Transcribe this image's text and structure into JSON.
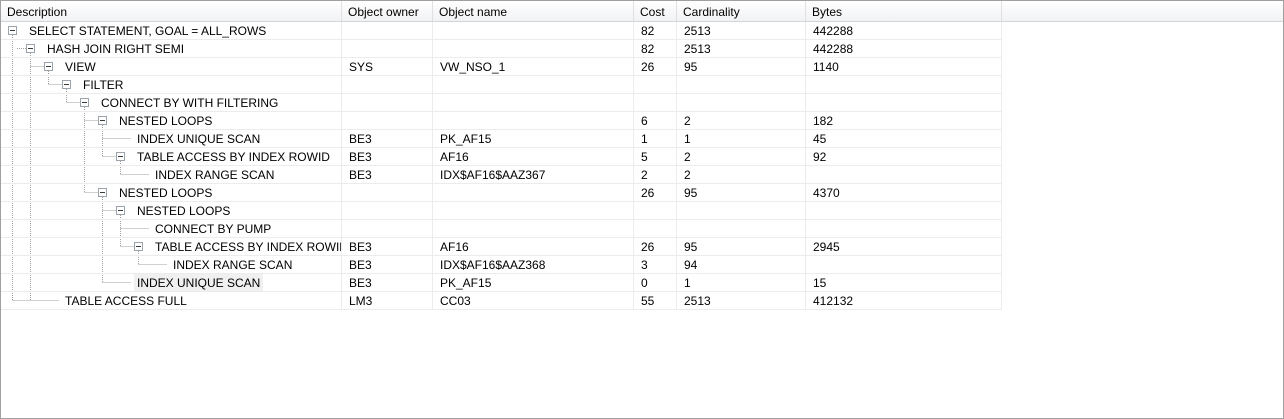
{
  "columns": {
    "description": "Description",
    "object_owner": "Object owner",
    "object_name": "Object name",
    "cost": "Cost",
    "cardinality": "Cardinality",
    "bytes": "Bytes"
  },
  "rows": [
    {
      "description": "SELECT STATEMENT, GOAL = ALL_ROWS",
      "owner": "",
      "name": "",
      "cost": "82",
      "cardinality": "2513",
      "bytes": "442288"
    },
    {
      "description": "HASH JOIN RIGHT SEMI",
      "owner": "",
      "name": "",
      "cost": "82",
      "cardinality": "2513",
      "bytes": "442288"
    },
    {
      "description": "VIEW",
      "owner": "SYS",
      "name": "VW_NSO_1",
      "cost": "26",
      "cardinality": "95",
      "bytes": "1140"
    },
    {
      "description": "FILTER",
      "owner": "",
      "name": "",
      "cost": "",
      "cardinality": "",
      "bytes": ""
    },
    {
      "description": "CONNECT BY WITH FILTERING",
      "owner": "",
      "name": "",
      "cost": "",
      "cardinality": "",
      "bytes": ""
    },
    {
      "description": "NESTED LOOPS",
      "owner": "",
      "name": "",
      "cost": "6",
      "cardinality": "2",
      "bytes": "182"
    },
    {
      "description": "INDEX UNIQUE SCAN",
      "owner": "BE3",
      "name": "PK_AF15",
      "cost": "1",
      "cardinality": "1",
      "bytes": "45"
    },
    {
      "description": "TABLE ACCESS BY INDEX ROWID",
      "owner": "BE3",
      "name": "AF16",
      "cost": "5",
      "cardinality": "2",
      "bytes": "92"
    },
    {
      "description": "INDEX RANGE SCAN",
      "owner": "BE3",
      "name": "IDX$AF16$AAZ367",
      "cost": "2",
      "cardinality": "2",
      "bytes": ""
    },
    {
      "description": "NESTED LOOPS",
      "owner": "",
      "name": "",
      "cost": "26",
      "cardinality": "95",
      "bytes": "4370"
    },
    {
      "description": "NESTED LOOPS",
      "owner": "",
      "name": "",
      "cost": "",
      "cardinality": "",
      "bytes": ""
    },
    {
      "description": "CONNECT BY PUMP",
      "owner": "",
      "name": "",
      "cost": "",
      "cardinality": "",
      "bytes": ""
    },
    {
      "description": "TABLE ACCESS BY INDEX ROWID",
      "owner": "BE3",
      "name": "AF16",
      "cost": "26",
      "cardinality": "95",
      "bytes": "2945"
    },
    {
      "description": "INDEX RANGE SCAN",
      "owner": "BE3",
      "name": "IDX$AF16$AAZ368",
      "cost": "3",
      "cardinality": "94",
      "bytes": ""
    },
    {
      "description": "INDEX UNIQUE SCAN",
      "owner": "BE3",
      "name": "PK_AF15",
      "cost": "0",
      "cardinality": "1",
      "bytes": "15"
    },
    {
      "description": "TABLE ACCESS FULL",
      "owner": "LM3",
      "name": "CC03",
      "cost": "55",
      "cardinality": "2513",
      "bytes": "412132"
    }
  ],
  "colors": {
    "border": "#a0a0a0",
    "grid_line": "#ececec",
    "tree_line": "#a0a0a0",
    "selected_row": "#f0f0f0"
  }
}
